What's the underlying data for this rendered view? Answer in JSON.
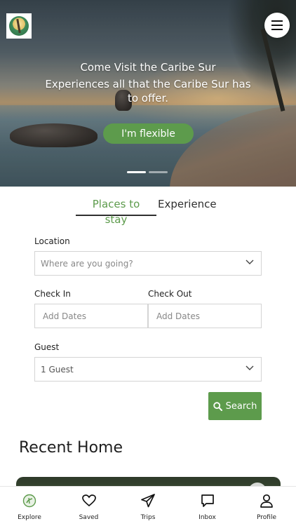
{
  "hero": {
    "title": "Come Visit the Caribe Sur",
    "subtitle": "Experiences all that the Caribe Sur has to offer.",
    "cta_label": "I'm flexible",
    "slide_count": 2,
    "active_slide": 1
  },
  "tabs": {
    "places_label": "Places to stay",
    "experience_label": "Experience",
    "active": "Places to stay"
  },
  "form": {
    "location_label": "Location",
    "location_placeholder": "Where are you going?",
    "check_in_label": "Check In",
    "check_in_placeholder": "Add Dates",
    "check_out_label": "Check Out",
    "check_out_placeholder": "Add Dates",
    "guest_label": "Guest",
    "guest_value": "1 Guest",
    "search_label": "Search"
  },
  "recent": {
    "title": "Recent Home"
  },
  "nav": {
    "items": [
      {
        "label": "Explore",
        "icon": "explore-icon"
      },
      {
        "label": "Saved",
        "icon": "heart-icon"
      },
      {
        "label": "Trips",
        "icon": "paper-plane-icon"
      },
      {
        "label": "Inbox",
        "icon": "chat-icon"
      },
      {
        "label": "Profile",
        "icon": "user-icon"
      }
    ]
  },
  "colors": {
    "accent": "#5d9b4c",
    "text": "#222222",
    "border": "#d4d4d4"
  }
}
